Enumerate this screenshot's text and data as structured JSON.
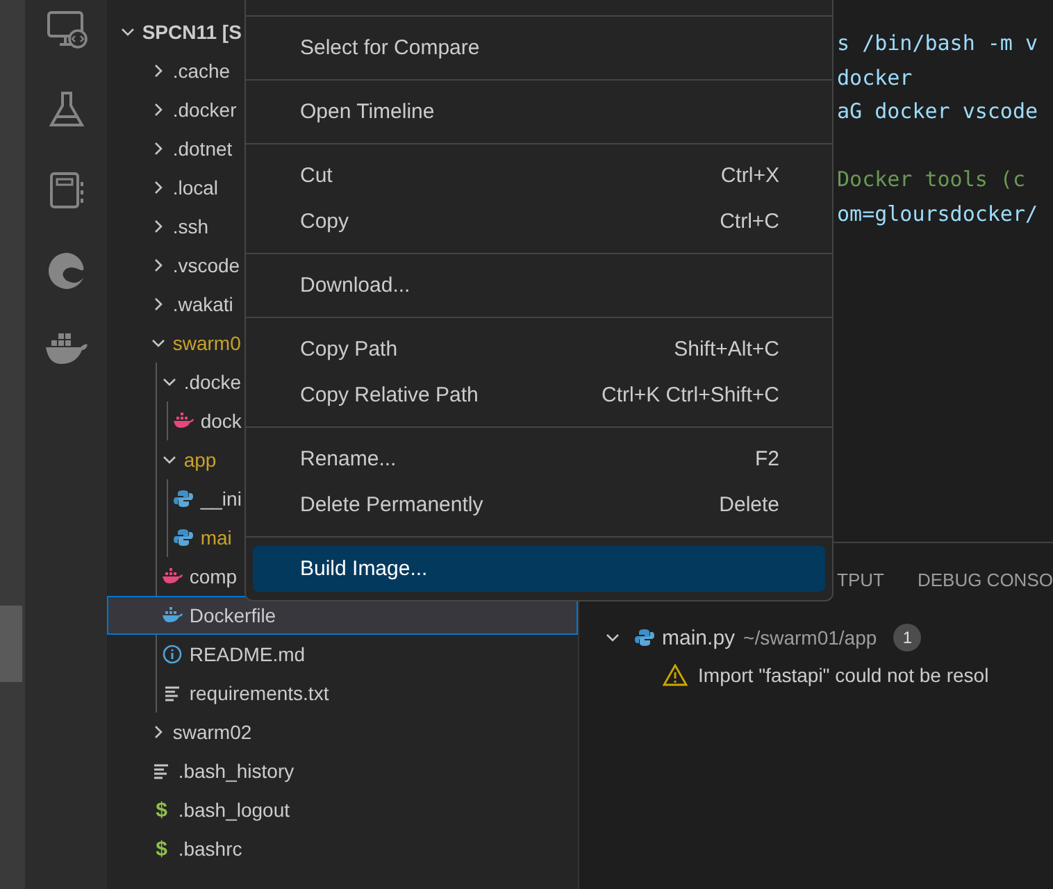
{
  "explorer": {
    "root": {
      "label": "SPCN11 [S",
      "expanded": true
    },
    "items": [
      {
        "label": ".cache",
        "kind": "folder",
        "expanded": false,
        "selected": false,
        "modified": false
      },
      {
        "label": ".docker",
        "kind": "folder",
        "expanded": false,
        "selected": false,
        "modified": false
      },
      {
        "label": ".dotnet",
        "kind": "folder",
        "expanded": false,
        "selected": false,
        "modified": false
      },
      {
        "label": ".local",
        "kind": "folder",
        "expanded": false,
        "selected": false,
        "modified": false
      },
      {
        "label": ".ssh",
        "kind": "folder",
        "expanded": false,
        "selected": false,
        "modified": false
      },
      {
        "label": ".vscode",
        "kind": "folder",
        "expanded": false,
        "selected": false,
        "modified": false
      },
      {
        "label": ".wakati",
        "kind": "folder",
        "expanded": false,
        "selected": false,
        "modified": false
      },
      {
        "label": "swarm0",
        "kind": "folder",
        "expanded": true,
        "selected": false,
        "modified": true,
        "children": [
          {
            "label": ".docke",
            "kind": "folder",
            "expanded": true,
            "selected": false,
            "modified": false,
            "children": [
              {
                "label": "dock",
                "kind": "compose",
                "selected": false,
                "modified": false
              }
            ]
          },
          {
            "label": "app",
            "kind": "folder",
            "expanded": true,
            "selected": false,
            "modified": true,
            "children": [
              {
                "label": "__ini",
                "kind": "python",
                "selected": false,
                "modified": false
              },
              {
                "label": "mai",
                "kind": "python",
                "selected": false,
                "modified": true
              }
            ]
          },
          {
            "label": "comp",
            "kind": "compose",
            "selected": false,
            "modified": false
          },
          {
            "label": "Dockerfile",
            "kind": "docker",
            "selected": true,
            "modified": false
          },
          {
            "label": "README.md",
            "kind": "info",
            "selected": false,
            "modified": false
          },
          {
            "label": "requirements.txt",
            "kind": "text",
            "selected": false,
            "modified": false
          }
        ]
      },
      {
        "label": "swarm02",
        "kind": "folder",
        "expanded": false,
        "selected": false,
        "modified": false
      },
      {
        "label": ".bash_history",
        "kind": "text",
        "selected": false,
        "modified": false
      },
      {
        "label": ".bash_logout",
        "kind": "shell",
        "icon": "$",
        "selected": false,
        "modified": false
      },
      {
        "label": ".bashrc",
        "kind": "shell",
        "icon": "$",
        "selected": false,
        "modified": false
      }
    ]
  },
  "editor": {
    "lines": [
      {
        "kind": "code",
        "text": "s /bin/bash -m v"
      },
      {
        "kind": "code",
        "text": "docker"
      },
      {
        "kind": "code",
        "text": "aG docker vscode"
      },
      {
        "kind": "blank"
      },
      {
        "kind": "comment",
        "text": "Docker tools (c"
      },
      {
        "kind": "code",
        "text": "om=gloursdocker/"
      }
    ]
  },
  "panel": {
    "tabs": [
      {
        "label": "TPUT",
        "selected": false
      },
      {
        "label": "DEBUG CONSO",
        "selected": false
      }
    ],
    "problems": [
      {
        "file": "main.py",
        "path": "~/swarm01/app",
        "count": "1",
        "expanded": true,
        "messages": [
          {
            "kind": "warning",
            "text": "Import \"fastapi\" could not be resol"
          }
        ]
      }
    ]
  },
  "context_menu": {
    "groups": [
      {
        "items": [
          {
            "label": "Select for Compare",
            "selected": false
          }
        ]
      },
      {
        "items": [
          {
            "label": "Open Timeline",
            "selected": false
          }
        ]
      },
      {
        "items": [
          {
            "label": "Cut",
            "shortcut": "Ctrl+X",
            "selected": false
          },
          {
            "label": "Copy",
            "shortcut": "Ctrl+C",
            "selected": false
          }
        ]
      },
      {
        "items": [
          {
            "label": "Download...",
            "selected": false
          }
        ]
      },
      {
        "items": [
          {
            "label": "Copy Path",
            "shortcut": "Shift+Alt+C",
            "selected": false
          },
          {
            "label": "Copy Relative Path",
            "shortcut": "Ctrl+K Ctrl+Shift+C",
            "selected": false
          }
        ]
      },
      {
        "items": [
          {
            "label": "Rename...",
            "shortcut": "F2",
            "selected": false
          },
          {
            "label": "Delete Permanently",
            "shortcut": "Delete",
            "selected": false
          }
        ]
      },
      {
        "items": [
          {
            "label": "Build Image...",
            "selected": true
          }
        ]
      }
    ]
  }
}
